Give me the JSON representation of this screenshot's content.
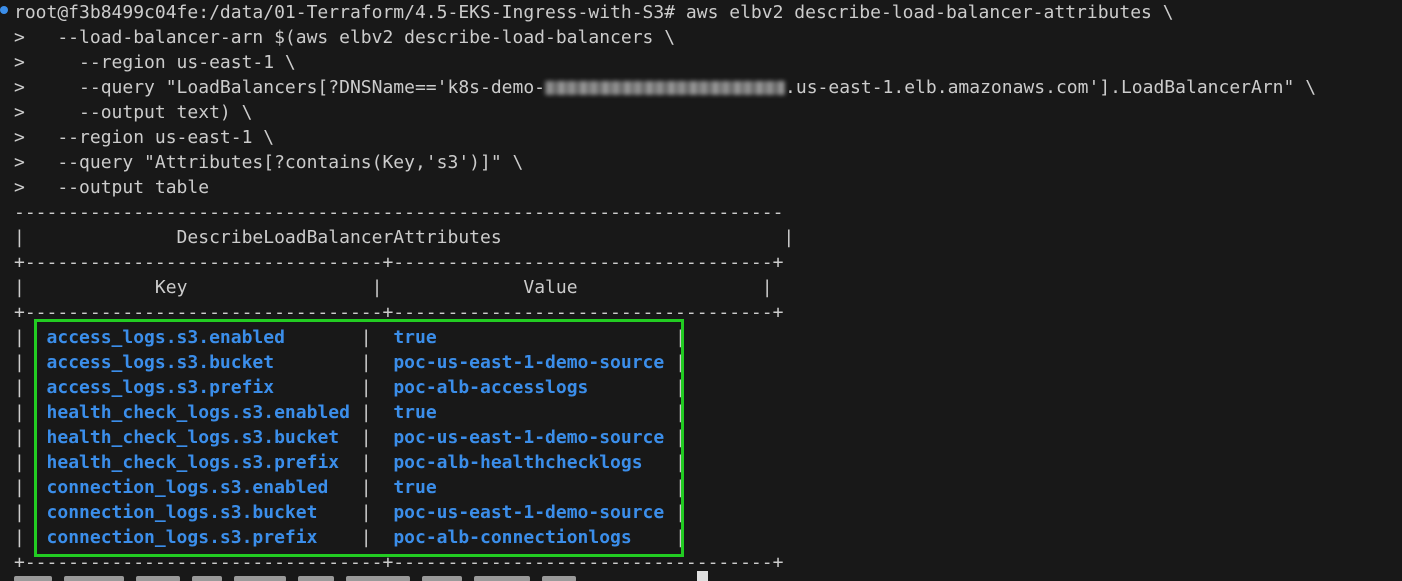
{
  "terminal": {
    "prompt": "root@f3b8499c04fe:/data/01-Terraform/4.5-EKS-Ingress-with-S3#",
    "command_line_1": " aws elbv2 describe-load-balancer-attributes \\",
    "continuation_lines": [
      ">   --load-balancer-arn $(aws elbv2 describe-load-balancers \\",
      ">     --region us-east-1 \\"
    ],
    "query_line_prefix": ">     --query \"LoadBalancers[?DNSName=='k8s-demo-",
    "query_line_suffix": ".us-east-1.elb.amazonaws.com'].LoadBalancerArn\" \\",
    "continuation_lines_2": [
      ">     --output text) \\",
      ">   --region us-east-1 \\",
      ">   --query \"Attributes[?contains(Key,'s3')]\" \\",
      ">   --output table"
    ]
  },
  "table": {
    "border_top": "-----------------------------------------------------------------------",
    "title_row": "|              DescribeLoadBalancerAttributes                          |",
    "separator": "+---------------------------------+-----------------------------------+",
    "header_key": "Key",
    "header_value": "Value",
    "rows": [
      {
        "key": "access_logs.s3.enabled",
        "value": "true"
      },
      {
        "key": "access_logs.s3.bucket",
        "value": "poc-us-east-1-demo-source"
      },
      {
        "key": "access_logs.s3.prefix",
        "value": "poc-alb-accesslogs"
      },
      {
        "key": "health_check_logs.s3.enabled",
        "value": "true"
      },
      {
        "key": "health_check_logs.s3.bucket",
        "value": "poc-us-east-1-demo-source"
      },
      {
        "key": "health_check_logs.s3.prefix",
        "value": "poc-alb-healthchecklogs"
      },
      {
        "key": "connection_logs.s3.enabled",
        "value": "true"
      },
      {
        "key": "connection_logs.s3.bucket",
        "value": "poc-us-east-1-demo-source"
      },
      {
        "key": "connection_logs.s3.prefix",
        "value": "poc-alb-connectionlogs"
      }
    ]
  },
  "colors": {
    "background": "#181818",
    "text": "#cccccc",
    "value_blue": "#3b8eea",
    "highlight_green": "#22cc22"
  }
}
